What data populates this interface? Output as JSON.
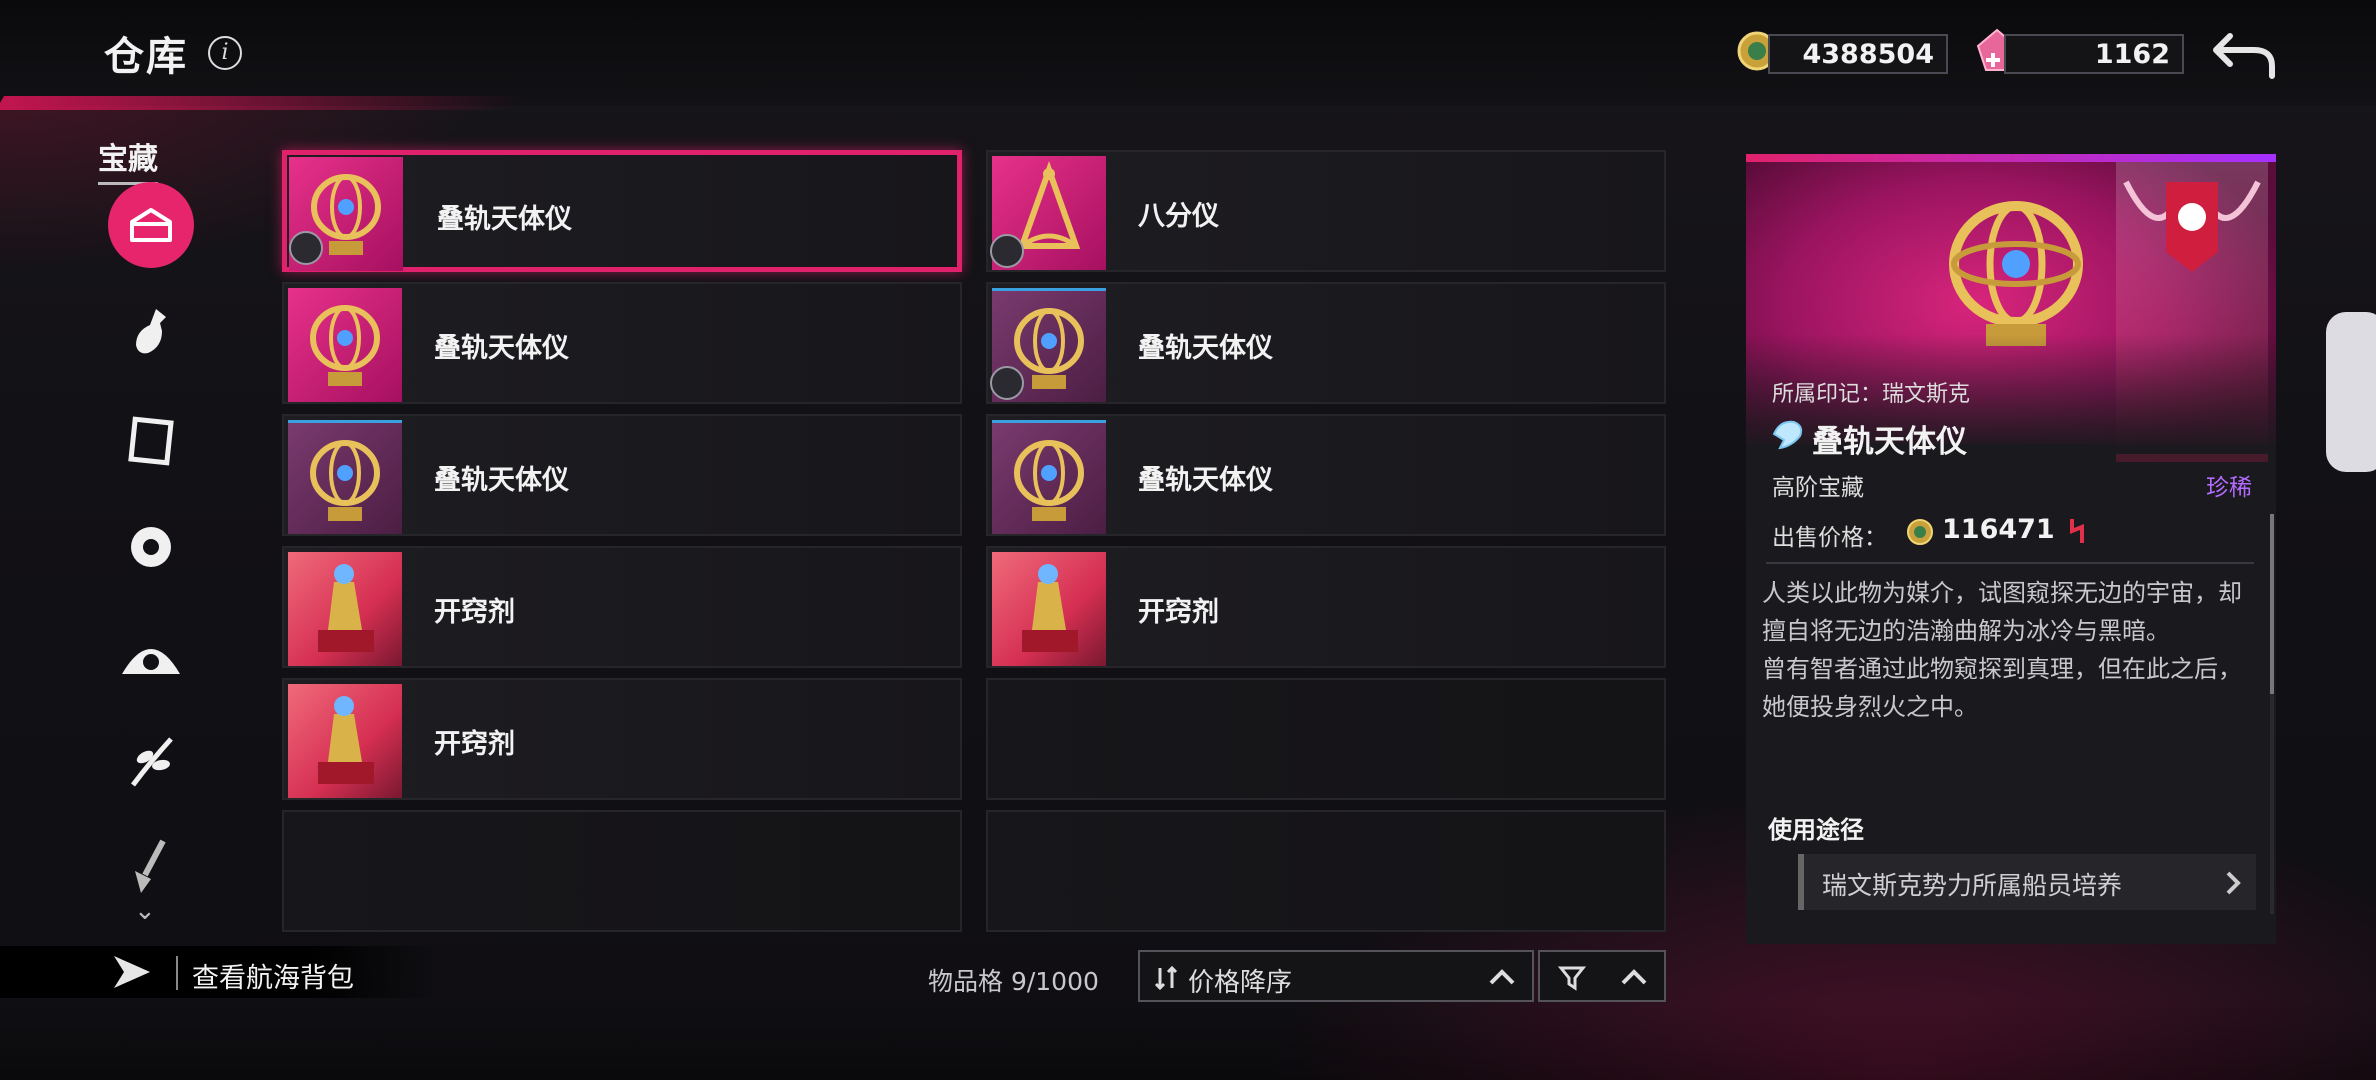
{
  "header": {
    "title": "仓库",
    "info_icon": "info-icon",
    "currencies": [
      {
        "icon": "gold-coin-icon",
        "value": "4388504"
      },
      {
        "icon": "gem-icon",
        "value": "1162"
      }
    ],
    "back_icon": "back-arrow-icon"
  },
  "sidebar": {
    "title": "宝藏",
    "items": [
      {
        "icon": "treasure-chest-icon",
        "active": true
      },
      {
        "icon": "potion-bottle-icon",
        "active": false
      },
      {
        "icon": "scroll-frame-icon",
        "active": false
      },
      {
        "icon": "gear-cog-icon",
        "active": false
      },
      {
        "icon": "ship-wheel-icon",
        "active": false
      },
      {
        "icon": "herb-plant-icon",
        "active": false
      },
      {
        "icon": "shovel-icon",
        "active": false
      }
    ],
    "more_icon": "chevron-down-icon"
  },
  "grid": {
    "cells": [
      {
        "name": "叠轨天体仪",
        "thumb": "pink",
        "badge": true,
        "selected": true
      },
      {
        "name": "八分仪",
        "thumb": "pink",
        "badge": true,
        "selected": false
      },
      {
        "name": "叠轨天体仪",
        "thumb": "pink",
        "badge": false,
        "selected": false
      },
      {
        "name": "叠轨天体仪",
        "thumb": "purple",
        "badge": true,
        "selected": false
      },
      {
        "name": "叠轨天体仪",
        "thumb": "purple",
        "badge": false,
        "selected": false
      },
      {
        "name": "叠轨天体仪",
        "thumb": "purple",
        "badge": false,
        "selected": false
      },
      {
        "name": "开窍剂",
        "thumb": "warm",
        "badge": false,
        "selected": false
      },
      {
        "name": "开窍剂",
        "thumb": "warm",
        "badge": false,
        "selected": false
      },
      {
        "name": "开窍剂",
        "thumb": "warm",
        "badge": false,
        "selected": false
      },
      {
        "name": "",
        "thumb": "",
        "badge": false,
        "selected": false
      },
      {
        "name": "",
        "thumb": "",
        "badge": false,
        "selected": false
      },
      {
        "name": "",
        "thumb": "",
        "badge": false,
        "selected": false
      }
    ]
  },
  "footer": {
    "sea_bag_label": "查看航海背包",
    "slots_text": "物品格 9/1000",
    "sort_label": "价格降序"
  },
  "detail": {
    "mark_label": "所属印记：瑞文斯克",
    "name": "叠轨天体仪",
    "type": "高阶宝藏",
    "rarity": "珍稀",
    "price_label": "出售价格：",
    "price": "116471",
    "description_1": "人类以此物为媒介，试图窥探无边的宇宙，却擅自将无边的浩瀚曲解为冰冷与黑暗。",
    "description_2": "曾有智者通过此物窥探到真理，但在此之后，她便投身烈火之中。",
    "use_title": "使用途径",
    "use_item": "瑞文斯克势力所属船员培养"
  },
  "colors": {
    "accent": "#e0226c",
    "rarity": "#b46bff"
  }
}
